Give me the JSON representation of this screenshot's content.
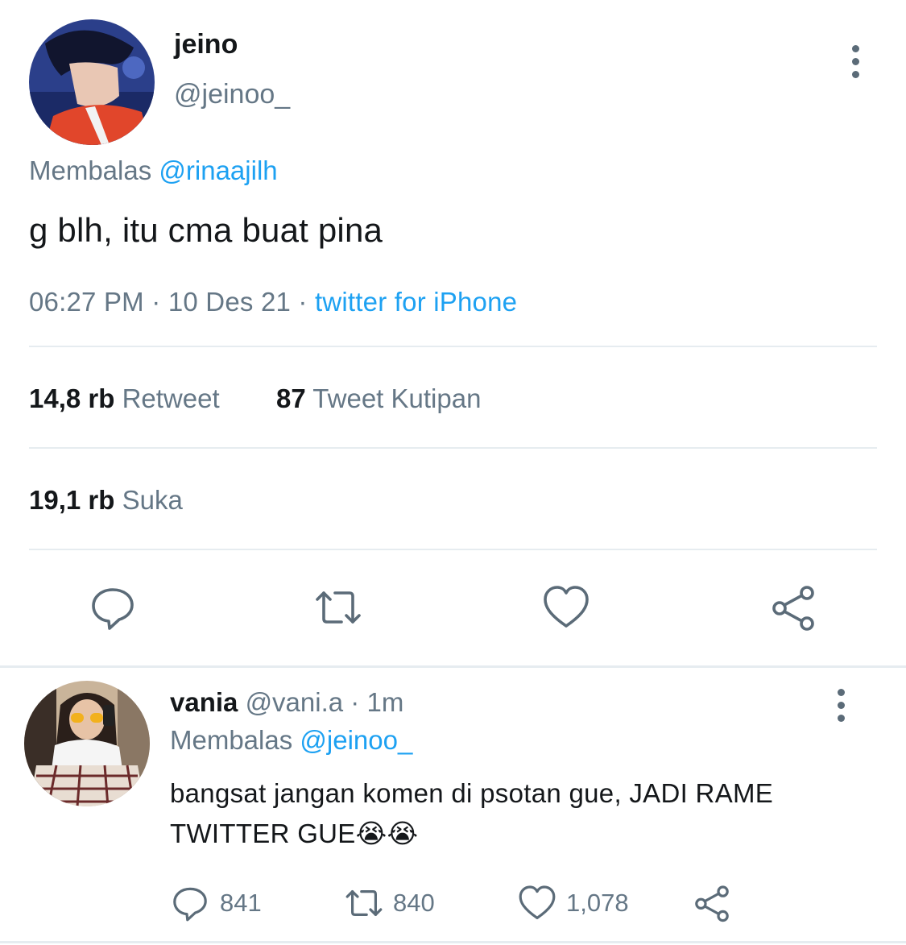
{
  "main_tweet": {
    "display_name": "jeino",
    "handle": "@jeinoo_",
    "replying_prefix": "Membalas",
    "replying_to": "@rinaajilh",
    "text": "g blh, itu cma buat pina",
    "time": "06:27 PM",
    "date": "10 Des 21",
    "source": "twitter for iPhone",
    "separator": "·",
    "stats": {
      "retweets_count": "14,8 rb",
      "retweets_label": "Retweet",
      "quotes_count": "87",
      "quotes_label": "Tweet Kutipan",
      "likes_count": "19,1 rb",
      "likes_label": "Suka"
    },
    "actions": [
      "reply-icon",
      "retweet-icon",
      "like-icon",
      "share-icon"
    ]
  },
  "reply_tweet": {
    "display_name": "vania",
    "handle": "@vani.a",
    "separator": "·",
    "time_ago": "1m",
    "replying_prefix": "Membalas",
    "replying_to": "@jeinoo_",
    "text": "bangsat jangan komen di psotan gue, JADI RAME TWITTER GUE😭😭",
    "counts": {
      "replies": "841",
      "retweets": "840",
      "likes": "1,078"
    }
  },
  "colors": {
    "accent": "#1da1f2",
    "secondary_text": "#657786",
    "primary_text": "#14171a",
    "divider": "#e6ecf0"
  }
}
